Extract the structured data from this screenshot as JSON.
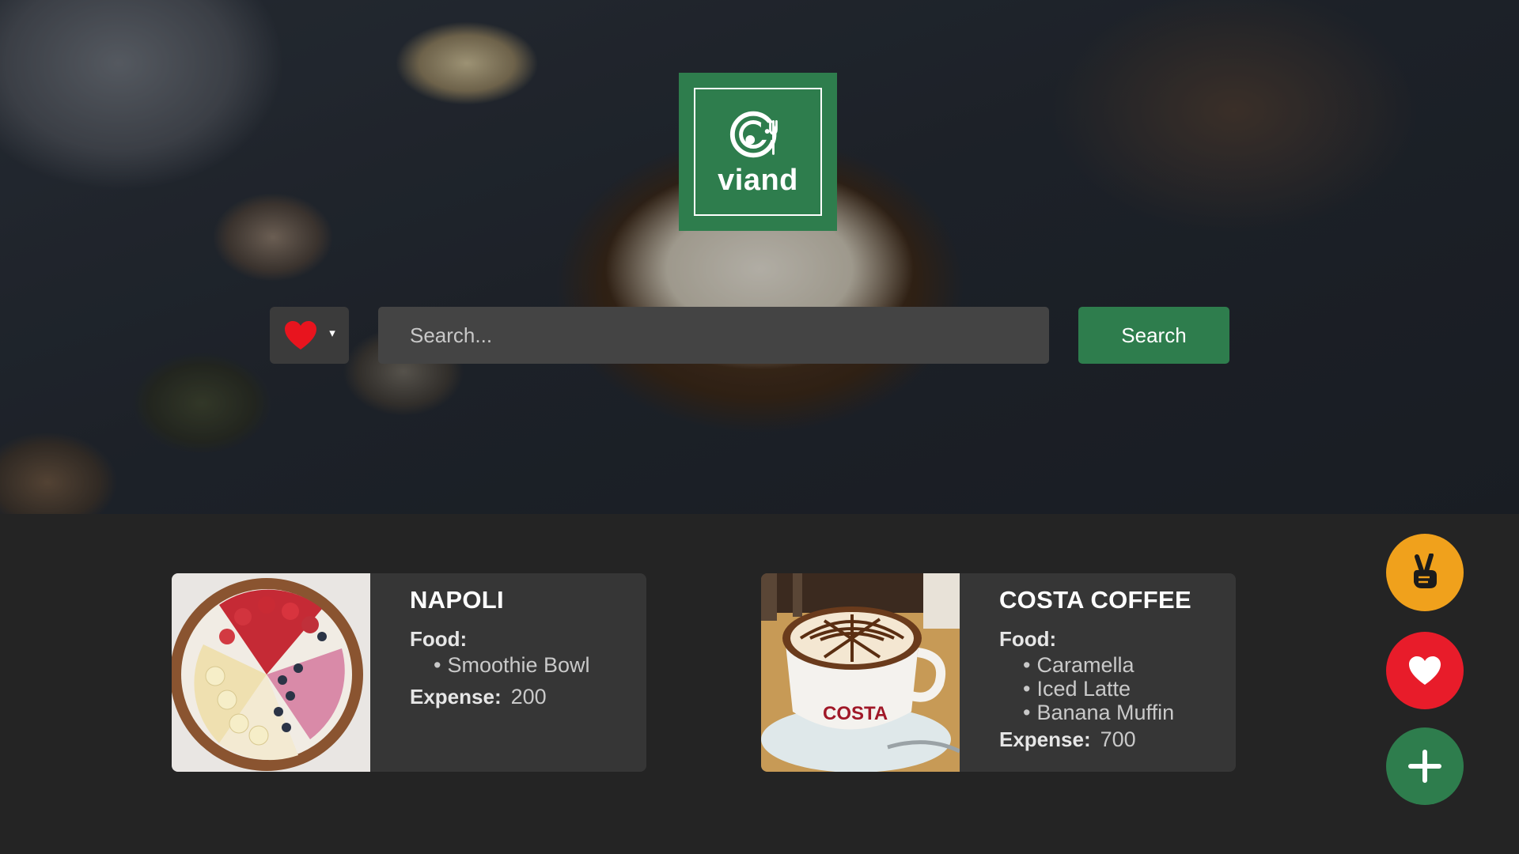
{
  "brand": {
    "logo_text": "viand",
    "icon": "plate-fork-icon",
    "color": "#2e7d4d"
  },
  "search": {
    "filter_icon": "heart-icon",
    "filter_caret": "▾",
    "placeholder": "Search...",
    "button_label": "Search"
  },
  "labels": {
    "food": "Food:",
    "expense": "Expense:"
  },
  "restaurants": [
    {
      "name": "NAPOLI",
      "image": "smoothie-bowl-photo",
      "foods": [
        "Smoothie Bowl"
      ],
      "expense": "200"
    },
    {
      "name": "COSTA COFFEE",
      "image": "coffee-cup-photo",
      "foods": [
        "Caramella",
        "Iced Latte",
        "Banana Muffin"
      ],
      "expense": "700"
    }
  ],
  "fabs": [
    {
      "icon": "peace-hand-icon",
      "color": "#f0a11c"
    },
    {
      "icon": "heart-icon",
      "color": "#e81c2a"
    },
    {
      "icon": "plus-icon",
      "color": "#2e7d4d"
    }
  ]
}
